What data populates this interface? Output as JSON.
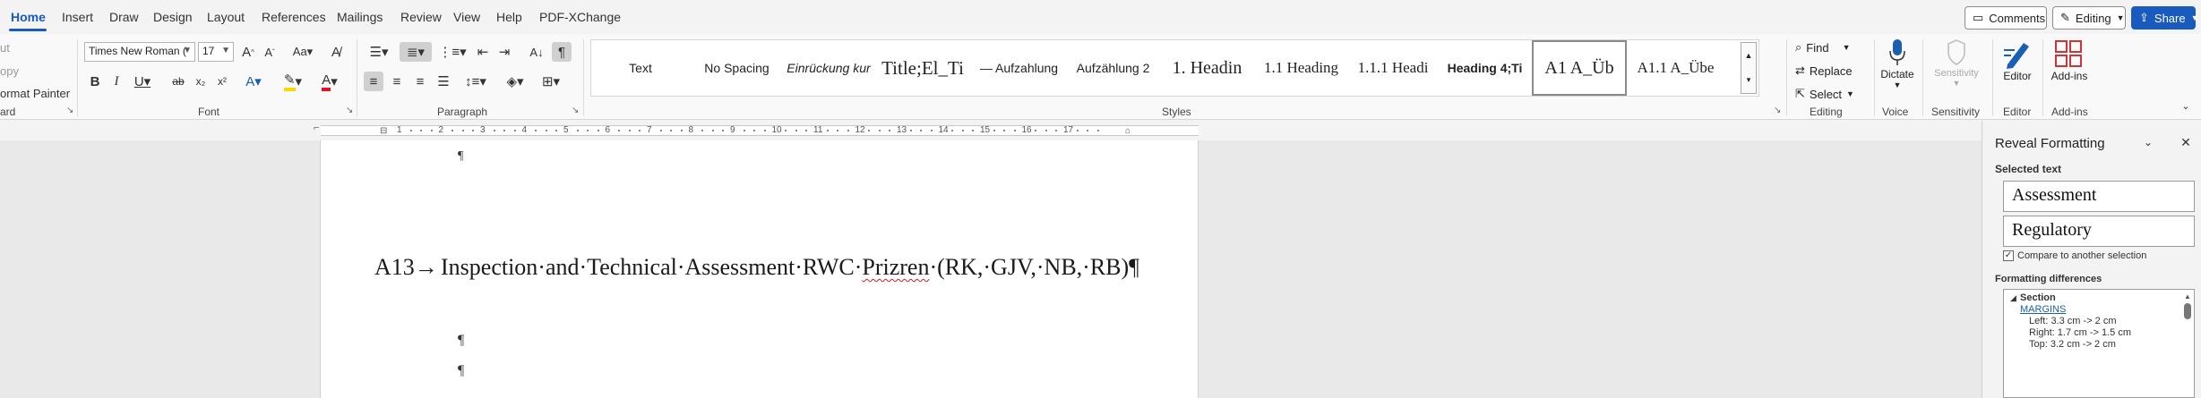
{
  "menu": {
    "tabs": [
      "Home",
      "Insert",
      "Draw",
      "Design",
      "Layout",
      "References",
      "Mailings",
      "Review",
      "View",
      "Help",
      "PDF-XChange"
    ],
    "comments": "Comments",
    "editing": "Editing",
    "share": "Share"
  },
  "clipboard": {
    "cut": "ut",
    "copy": "opy",
    "format_painter": "ormat Painter",
    "label": "ard"
  },
  "font": {
    "family": "Times New Roman (",
    "size": "17",
    "label": "Font"
  },
  "paragraph": {
    "label": "Paragraph"
  },
  "styles": {
    "items": [
      "Text",
      "No Spacing",
      "Einrückung kur",
      "Title;El_Ti",
      "— Aufzahlung",
      "Aufzählung 2",
      "1. Headin",
      "1.1 Heading",
      "1.1.1 Headi",
      "Heading 4;Ti",
      "A1 A_Üb",
      "A1.1 A_Übe"
    ],
    "label": "Styles"
  },
  "editing_group": {
    "find": "Find",
    "replace": "Replace",
    "select": "Select",
    "label": "Editing"
  },
  "voice": {
    "dictate": "Dictate",
    "label": "Voice"
  },
  "sensitivity": {
    "button": "Sensitivity",
    "label": "Sensitivity"
  },
  "editor": {
    "button": "Editor",
    "label": "Editor"
  },
  "addins": {
    "button": "Add-ins",
    "label": "Add-ins"
  },
  "ruler": {
    "numbers": [
      "1",
      "2",
      "3",
      "4",
      "5",
      "6",
      "7",
      "8",
      "9",
      "10",
      "11",
      "12",
      "13",
      "14",
      "15",
      "16",
      "17"
    ]
  },
  "document": {
    "pilcrow": "¶",
    "heading_number": "A13",
    "heading_arrow": "→",
    "heading_text_before": "Inspection·and·Technical·Assessment·RWC·",
    "heading_misspelled": "Prizren",
    "heading_text_after": "·(RK,·GJV,·NB,·RB)¶"
  },
  "reveal_pane": {
    "title": "Reveal Formatting",
    "selected_text_label": "Selected text",
    "selection_1": "Assessment",
    "selection_2": "Regulatory",
    "compare_label": "Compare to another selection",
    "differences_label": "Formatting differences",
    "section_label": "Section",
    "margins_link": "MARGINS",
    "diff_left": "Left:  3.3 cm ->  2 cm",
    "diff_right": "Right:  1.7 cm ->  1.5 cm",
    "diff_top": "Top:  3.2 cm ->  2 cm"
  },
  "colors": {
    "accent": "#185abd",
    "highlight": "#ffd700",
    "font_color": "#e81123",
    "editor_blue": "#1a5fb4",
    "addins_red": "#d13438"
  }
}
